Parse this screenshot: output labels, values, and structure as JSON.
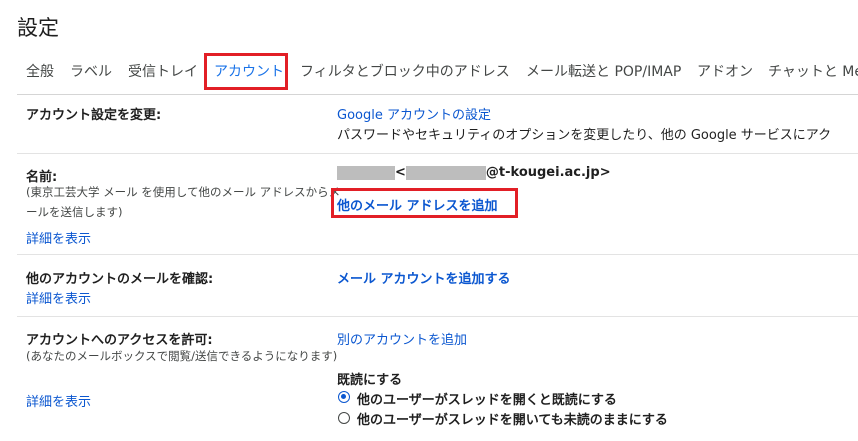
{
  "page": {
    "title": "設定"
  },
  "tabs": [
    {
      "label": "全般"
    },
    {
      "label": "ラベル"
    },
    {
      "label": "受信トレイ"
    },
    {
      "label": "アカウント",
      "active": true
    },
    {
      "label": "フィルタとブロック中のアドレス"
    },
    {
      "label": "メール転送と POP/IMAP"
    },
    {
      "label": "アドオン"
    },
    {
      "label": "チャットと Me"
    }
  ],
  "sections": {
    "change_account": {
      "label": "アカウント設定を変更:",
      "link": "Google アカウントの設定",
      "description": "パスワードやセキュリティのオプションを変更したり、他の Google サービスにアク"
    },
    "name": {
      "label": "名前:",
      "note": "(東京工芸大学 メール を使用して他のメール アドレスからメールを送信します)",
      "details_link": "詳細を表示",
      "email_open": "<",
      "email_suffix": "@t-kougei.ac.jp>",
      "add_link": "他のメール アドレスを追加"
    },
    "check_mail": {
      "label": "他のアカウントのメールを確認:",
      "details_link": "詳細を表示",
      "add_link": "メール アカウントを追加する"
    },
    "grant_access": {
      "label": "アカウントへのアクセスを許可:",
      "note": "(あなたのメールボックスで閲覧/送信できるようになります)",
      "details_link": "詳細を表示",
      "add_link": "別のアカウントを追加",
      "read_label": "既読にする",
      "options": [
        {
          "label": "他のユーザーがスレッドを開くと既読にする",
          "selected": true
        },
        {
          "label": "他のユーザーがスレッドを開いても未読のままにする",
          "selected": false
        }
      ]
    }
  },
  "colors": {
    "accent": "#0b57d0",
    "highlight": "#e21f26",
    "active_tab": "#1a73e8"
  }
}
